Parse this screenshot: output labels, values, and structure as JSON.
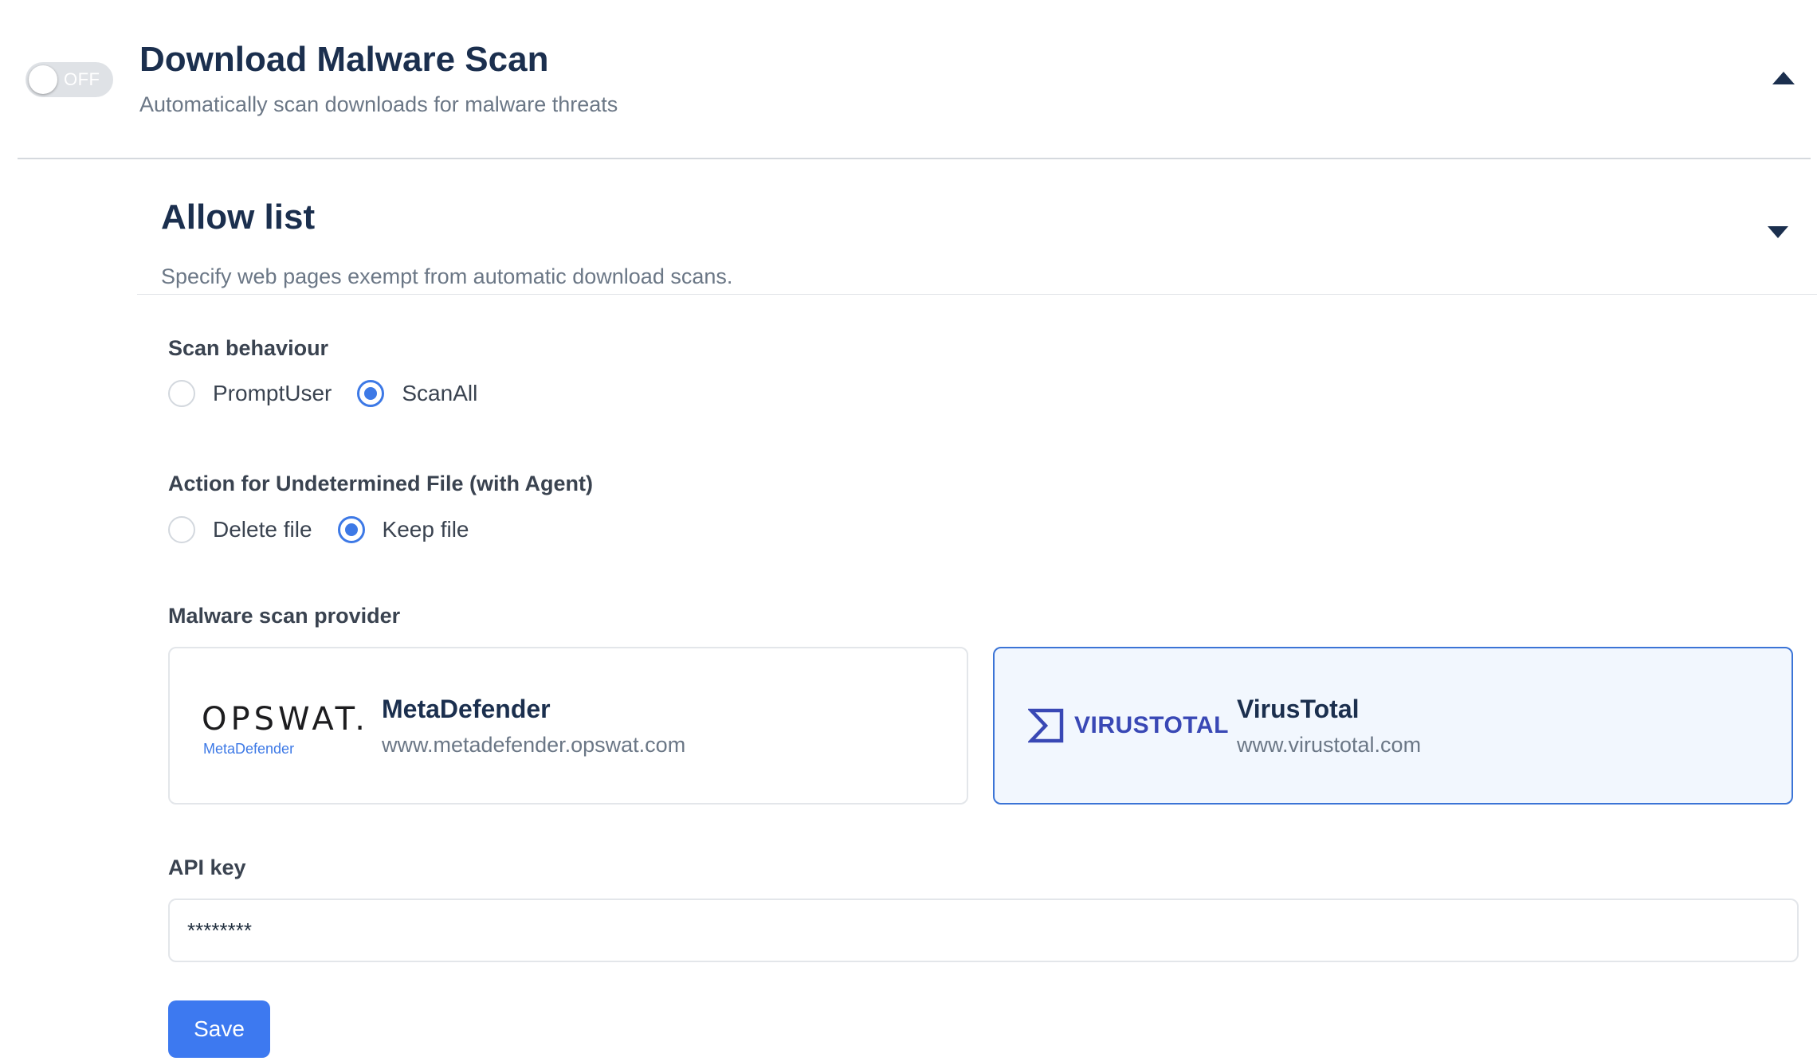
{
  "header": {
    "toggle_label": "OFF",
    "title": "Download Malware Scan",
    "subtitle": "Automatically scan downloads for malware threats"
  },
  "allow_list": {
    "title": "Allow list",
    "subtitle": "Specify web pages exempt from automatic download scans."
  },
  "scan_behaviour": {
    "label": "Scan behaviour",
    "options": [
      {
        "label": "PromptUser",
        "checked": false
      },
      {
        "label": "ScanAll",
        "checked": true
      }
    ]
  },
  "undetermined_action": {
    "label": "Action for Undetermined File (with Agent)",
    "options": [
      {
        "label": "Delete file",
        "checked": false
      },
      {
        "label": "Keep file",
        "checked": true
      }
    ]
  },
  "provider": {
    "label": "Malware scan provider",
    "cards": [
      {
        "name": "MetaDefender",
        "url": "www.metadefender.opswat.com",
        "logo_text": "OPSWAT.",
        "logo_subtext": "MetaDefender",
        "selected": false
      },
      {
        "name": "VirusTotal",
        "url": "www.virustotal.com",
        "logo_text": "VIRUSTOTAL",
        "selected": true
      }
    ]
  },
  "api_key": {
    "label": "API key",
    "value": "********"
  },
  "actions": {
    "save_label": "Save"
  },
  "colors": {
    "accent": "#3d79f0",
    "heading": "#1b2f4e",
    "muted": "#6b7786",
    "selected_card_border": "#3b74d6",
    "selected_card_bg": "#f2f7fe",
    "virustotal_brand": "#3948b5"
  },
  "icons": {
    "collapse": "chevron-up-icon",
    "expand": "chevron-down-icon"
  }
}
